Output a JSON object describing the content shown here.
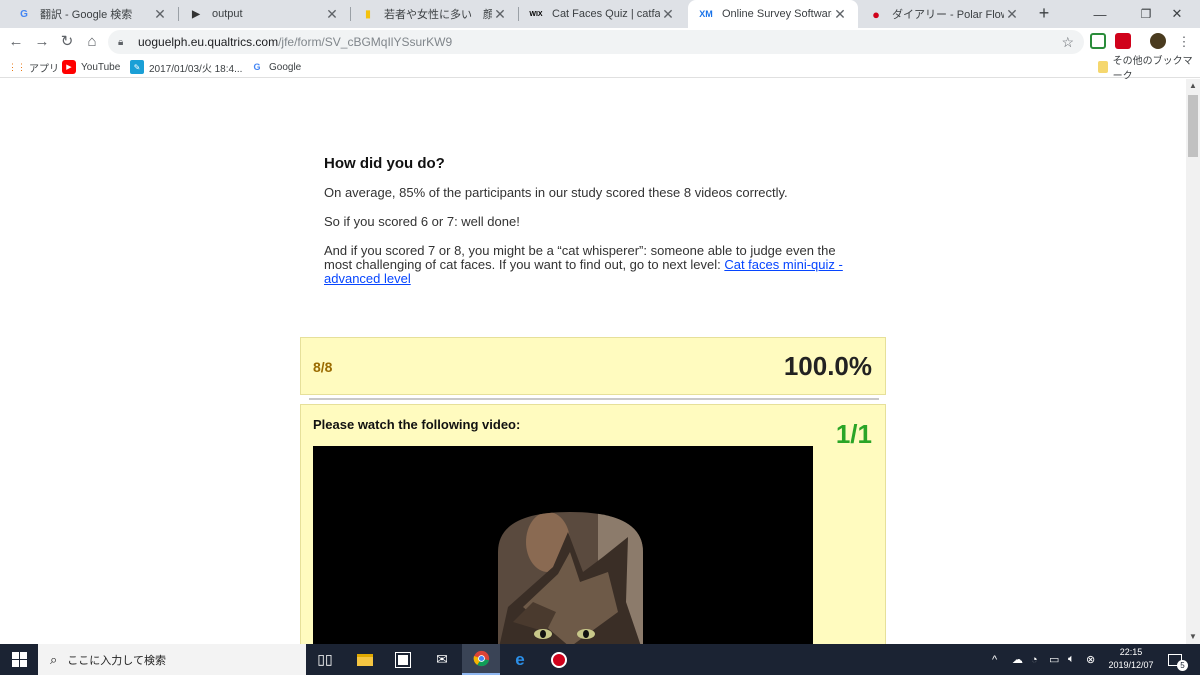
{
  "tabs": [
    {
      "title": "翻訳 - Google 検索",
      "favicon": "G",
      "favicon_color": "#4285f4"
    },
    {
      "title": "output",
      "favicon": "▶",
      "favicon_color": "#333333"
    },
    {
      "title": "若者や女性に多い　顔の表情　",
      "favicon": "▮",
      "favicon_color": "#f4c20d"
    },
    {
      "title": "Cat Faces Quiz | catfaces",
      "favicon": "WIX",
      "favicon_color": "#000000"
    },
    {
      "title": "Online Survey Software | Qua",
      "favicon": "XM",
      "favicon_color": "#1a73e8"
    },
    {
      "title": "ダイアリー - Polar Flow",
      "favicon": "●",
      "favicon_color": "#d0021b"
    }
  ],
  "new_tab_label": "+",
  "window_controls": {
    "minimize": "—",
    "maximize": "❐",
    "close": "✕"
  },
  "toolbar": {
    "url_host": "uoguelph.eu.qualtrics.com",
    "url_path": "/jfe/form/SV_cBGMqIlYSsurKW9"
  },
  "bookmarks": {
    "items": [
      {
        "label": "アプリ",
        "icon": "apps-grid-icon"
      },
      {
        "label": "YouTube",
        "icon": "youtube-icon"
      },
      {
        "label": "2017/01/03/火 18:4...",
        "icon": "calendar-icon"
      },
      {
        "label": "Google",
        "icon": "google-icon"
      }
    ],
    "other_label": "その他のブックマーク"
  },
  "content": {
    "heading": "How did you do?",
    "para1": "On average, 85% of the participants in our study scored these 8 videos correctly.",
    "para2": "So if you scored 6 or 7: well done!",
    "para3": "And if you scored 7 or 8, you might be a “cat whisperer”: someone able to judge even the most challenging of cat faces. If you want to find out, go to next level: ",
    "link_text": "Cat faces mini-quiz - advanced level"
  },
  "score": {
    "fraction": "8/8",
    "percent": "100.0%"
  },
  "question": {
    "title": "Please watch the following video:",
    "score": "1/1"
  },
  "taskbar": {
    "search_placeholder": "ここに入力して検索",
    "time": "22:15",
    "date": "2019/12/07",
    "notification_count": "5"
  },
  "colors": {
    "score_box_bg": "#fffbbf",
    "fraction_color": "#9a6b00",
    "question_score_color": "#2aa527",
    "link_color": "#0645ff"
  }
}
